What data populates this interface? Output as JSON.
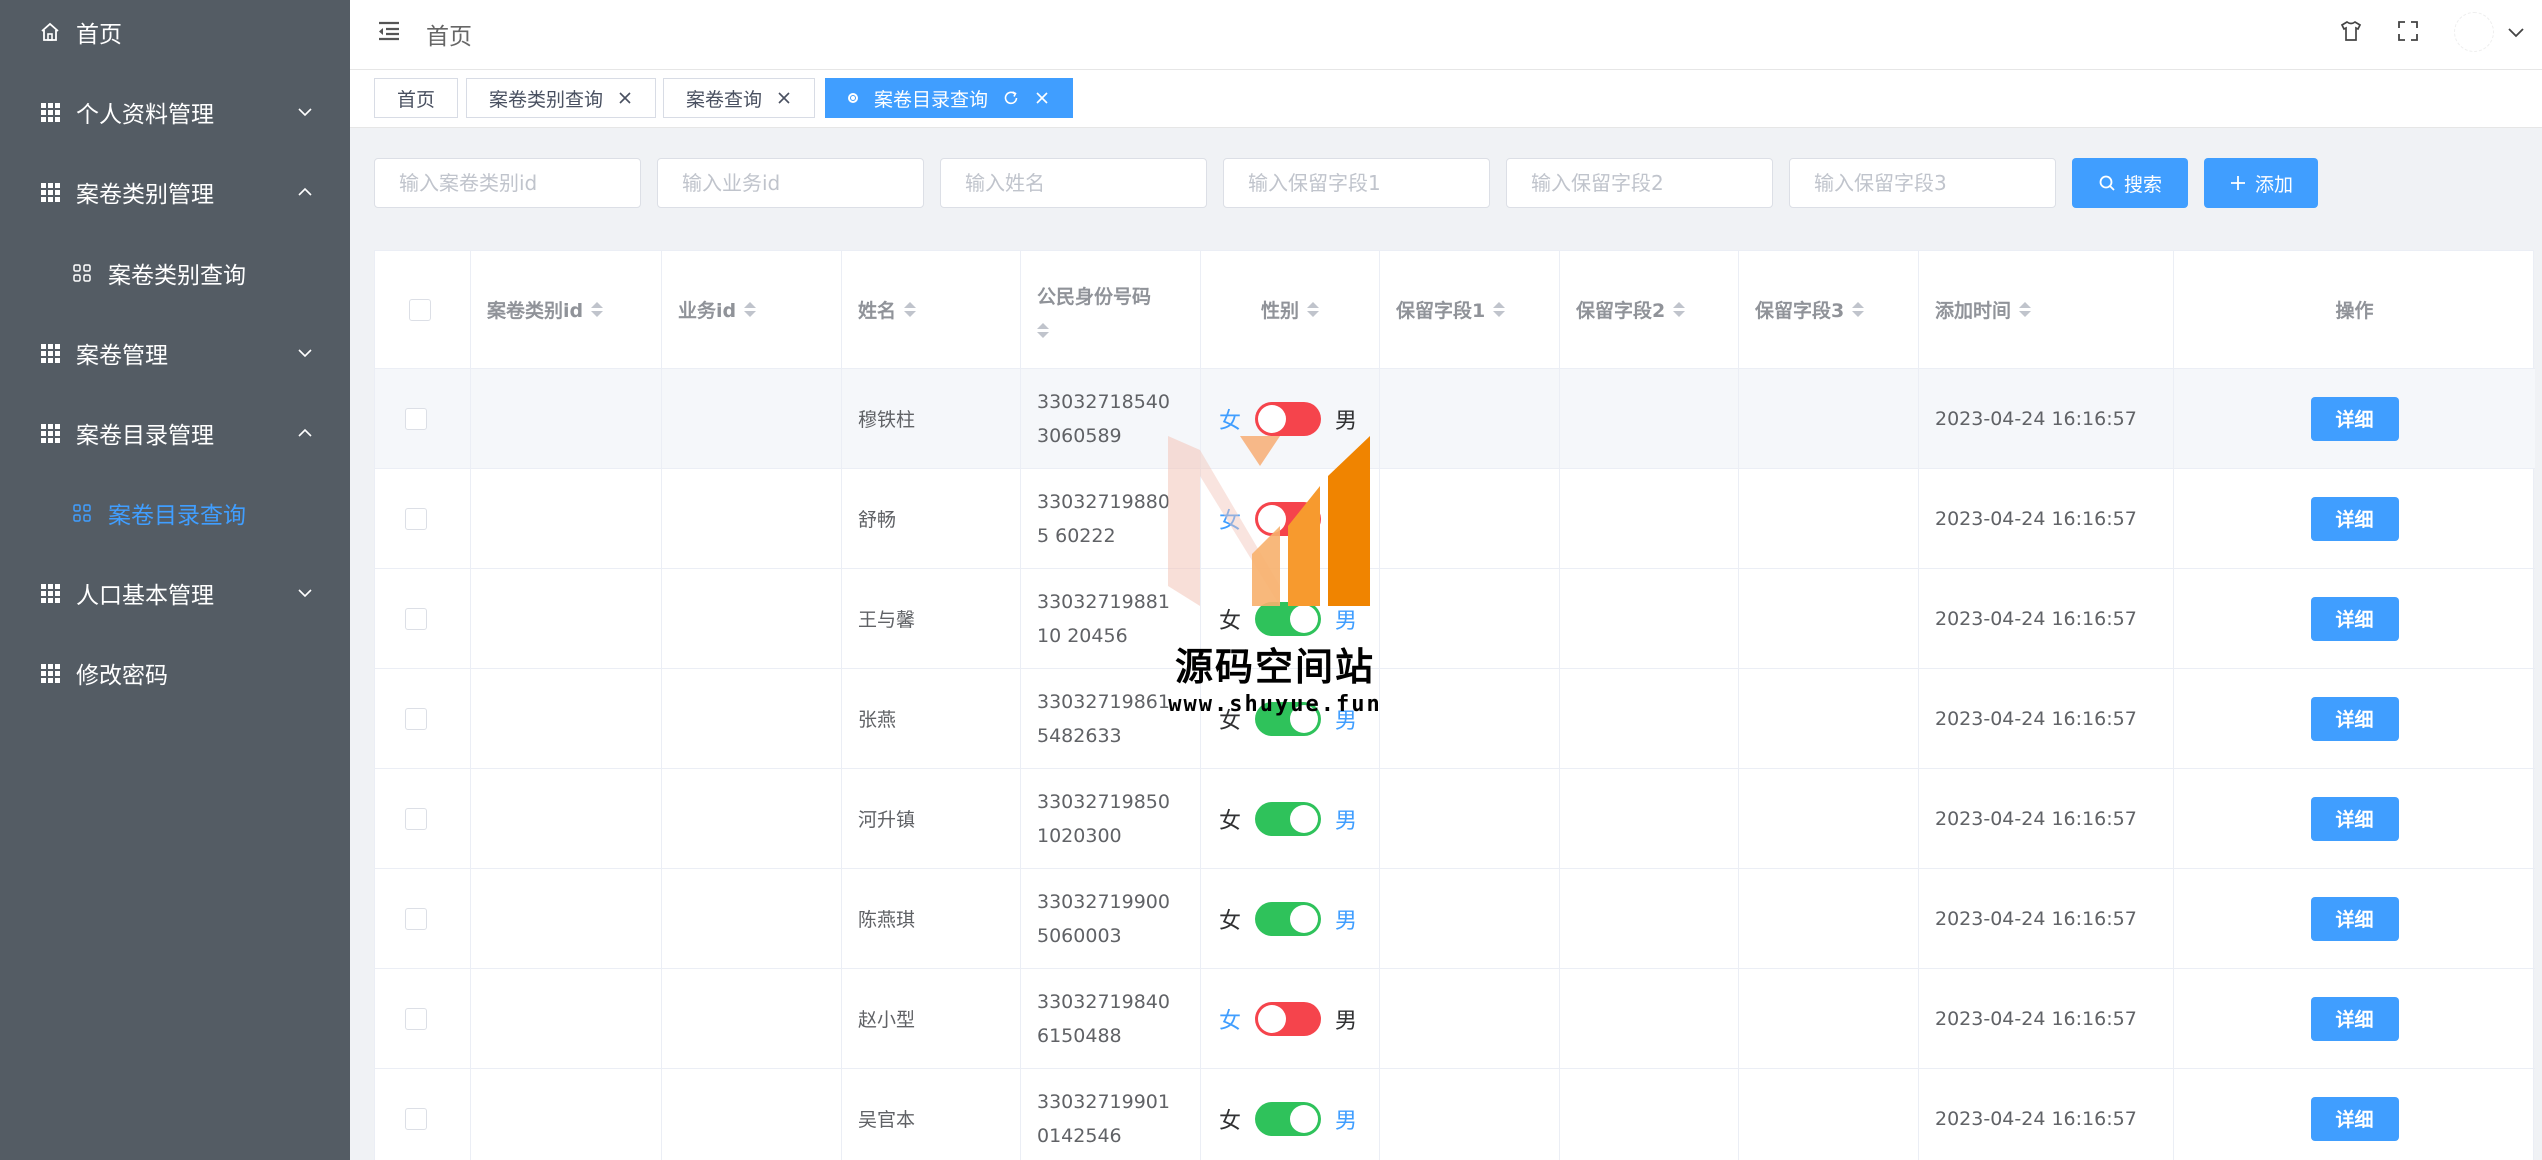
{
  "colors": {
    "sidebar_bg": "#545c64",
    "primary": "#409eff",
    "switch_on": "#2fc25b",
    "switch_off": "#f5444c"
  },
  "sidebar": {
    "items": [
      {
        "label": "首页",
        "icon": "home-icon"
      },
      {
        "label": "个人资料管理",
        "icon": "grid-icon",
        "arrow": "chevron-down-icon"
      },
      {
        "label": "案卷类别管理",
        "icon": "grid-icon",
        "arrow": "chevron-up-icon"
      },
      {
        "label": "案卷类别查询",
        "icon": "apps-icon",
        "sub": true
      },
      {
        "label": "案卷管理",
        "icon": "grid-icon",
        "arrow": "chevron-down-icon"
      },
      {
        "label": "案卷目录管理",
        "icon": "grid-icon",
        "arrow": "chevron-up-icon"
      },
      {
        "label": "案卷目录查询",
        "icon": "apps-icon",
        "sub": true,
        "active": true
      },
      {
        "label": "人口基本管理",
        "icon": "grid-icon",
        "arrow": "chevron-down-icon"
      },
      {
        "label": "修改密码",
        "icon": "grid-icon"
      }
    ]
  },
  "header": {
    "breadcrumb": "首页"
  },
  "tags": [
    {
      "label": "首页"
    },
    {
      "label": "案卷类别查询"
    },
    {
      "label": "案卷查询"
    },
    {
      "label": "案卷目录查询",
      "active": true
    }
  ],
  "search": {
    "placeholders": [
      "输入案卷类别id",
      "输入业务id",
      "输入姓名",
      "输入保留字段1",
      "输入保留字段2",
      "输入保留字段3"
    ],
    "search_label": "搜索",
    "add_label": "添加"
  },
  "table": {
    "columns": [
      "案卷类别id",
      "业务id",
      "姓名",
      "公民身份号码",
      "性别",
      "保留字段1",
      "保留字段2",
      "保留字段3",
      "添加时间",
      "操作"
    ],
    "gender_female": "女",
    "gender_male": "男",
    "detail_label": "详细",
    "rows": [
      {
        "name": "穆铁柱",
        "id": "330327185403060589",
        "male": false,
        "time": "2023-04-24 16:16:57"
      },
      {
        "name": "舒畅",
        "id": "330327198805 60222",
        "male": false,
        "time": "2023-04-24 16:16:57"
      },
      {
        "name": "王与馨",
        "id": "3303271988110 20456",
        "male": true,
        "time": "2023-04-24 16:16:57"
      },
      {
        "name": "张燕",
        "id": "33032719861 5482633",
        "male": true,
        "time": "2023-04-24 16:16:57"
      },
      {
        "name": "河升镇",
        "id": "330327198501020300",
        "male": true,
        "time": "2023-04-24 16:16:57"
      },
      {
        "name": "陈燕琪",
        "id": "330327199005060003",
        "male": true,
        "time": "2023-04-24 16:16:57"
      },
      {
        "name": "赵小型",
        "id": "330327198406150488",
        "male": false,
        "time": "2023-04-24 16:16:57"
      },
      {
        "name": "吴官本",
        "id": "330327199010142546",
        "male": true,
        "time": "2023-04-24 16:16:57"
      }
    ]
  },
  "watermark": {
    "title": "源码空间站",
    "url": "www.shuyue.fun"
  }
}
